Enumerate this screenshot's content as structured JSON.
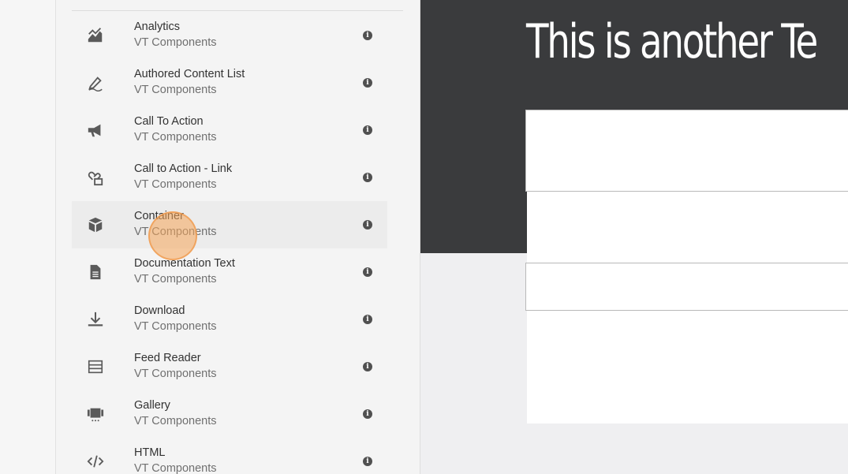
{
  "components_panel": {
    "items": [
      {
        "title": "Analytics",
        "group": "VT Components",
        "icon": "analytics-chart-icon"
      },
      {
        "title": "Authored Content List",
        "group": "VT Components",
        "icon": "pen-icon"
      },
      {
        "title": "Call To Action",
        "group": "VT Components",
        "icon": "megaphone-icon"
      },
      {
        "title": "Call to Action - Link",
        "group": "VT Components",
        "icon": "link-icon"
      },
      {
        "title": "Container",
        "group": "VT Components",
        "icon": "box-icon"
      },
      {
        "title": "Documentation Text",
        "group": "VT Components",
        "icon": "document-icon"
      },
      {
        "title": "Download",
        "group": "VT Components",
        "icon": "download-icon"
      },
      {
        "title": "Feed Reader",
        "group": "VT Components",
        "icon": "feed-list-icon"
      },
      {
        "title": "Gallery",
        "group": "VT Components",
        "icon": "gallery-icon"
      },
      {
        "title": "HTML",
        "group": "VT Components",
        "icon": "code-icon"
      }
    ],
    "info_glyph": "i"
  },
  "page_canvas": {
    "hero_title": "This is another Te"
  }
}
